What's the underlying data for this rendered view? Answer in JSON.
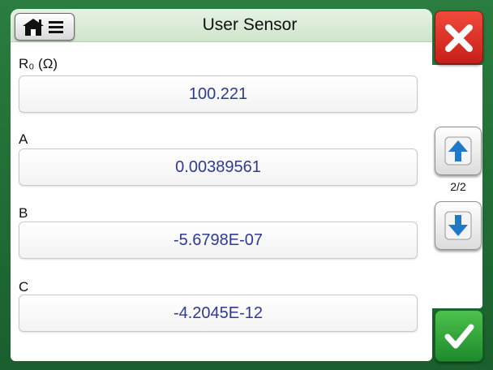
{
  "header": {
    "title": "User Sensor"
  },
  "fields": [
    {
      "label": "R₀ (Ω)",
      "value": "100.221"
    },
    {
      "label": "A",
      "value": "0.00389561"
    },
    {
      "label": "B",
      "value": "-5.6798E-07"
    },
    {
      "label": "C",
      "value": "-4.2045E-12"
    }
  ],
  "pager": {
    "indicator": "2/2"
  },
  "colors": {
    "frame": "#1d6b32",
    "close": "#d62b22",
    "ok": "#2f9e3a",
    "value_text": "#2e3a93",
    "arrow": "#1f78c8"
  },
  "icons": {
    "home": "home-icon",
    "menu": "menu-icon",
    "close": "close-icon",
    "up": "arrow-up-icon",
    "down": "arrow-down-icon",
    "ok": "checkmark-icon"
  }
}
